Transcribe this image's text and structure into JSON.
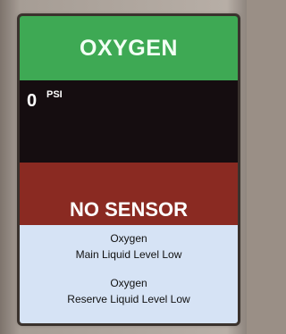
{
  "header": {
    "title": "OXYGEN"
  },
  "reading": {
    "value": "0",
    "unit": "PSI"
  },
  "alarm": {
    "status": "NO SENSOR"
  },
  "messages": [
    {
      "line1": "Oxygen",
      "line2": "Main Liquid Level Low"
    },
    {
      "line1": "Oxygen",
      "line2": "Reserve Liquid Level Low"
    }
  ],
  "colors": {
    "header_bg": "#3ea954",
    "reading_bg": "#150d10",
    "alarm_bg": "#8a2a22",
    "messages_bg": "#d6e3f5"
  }
}
